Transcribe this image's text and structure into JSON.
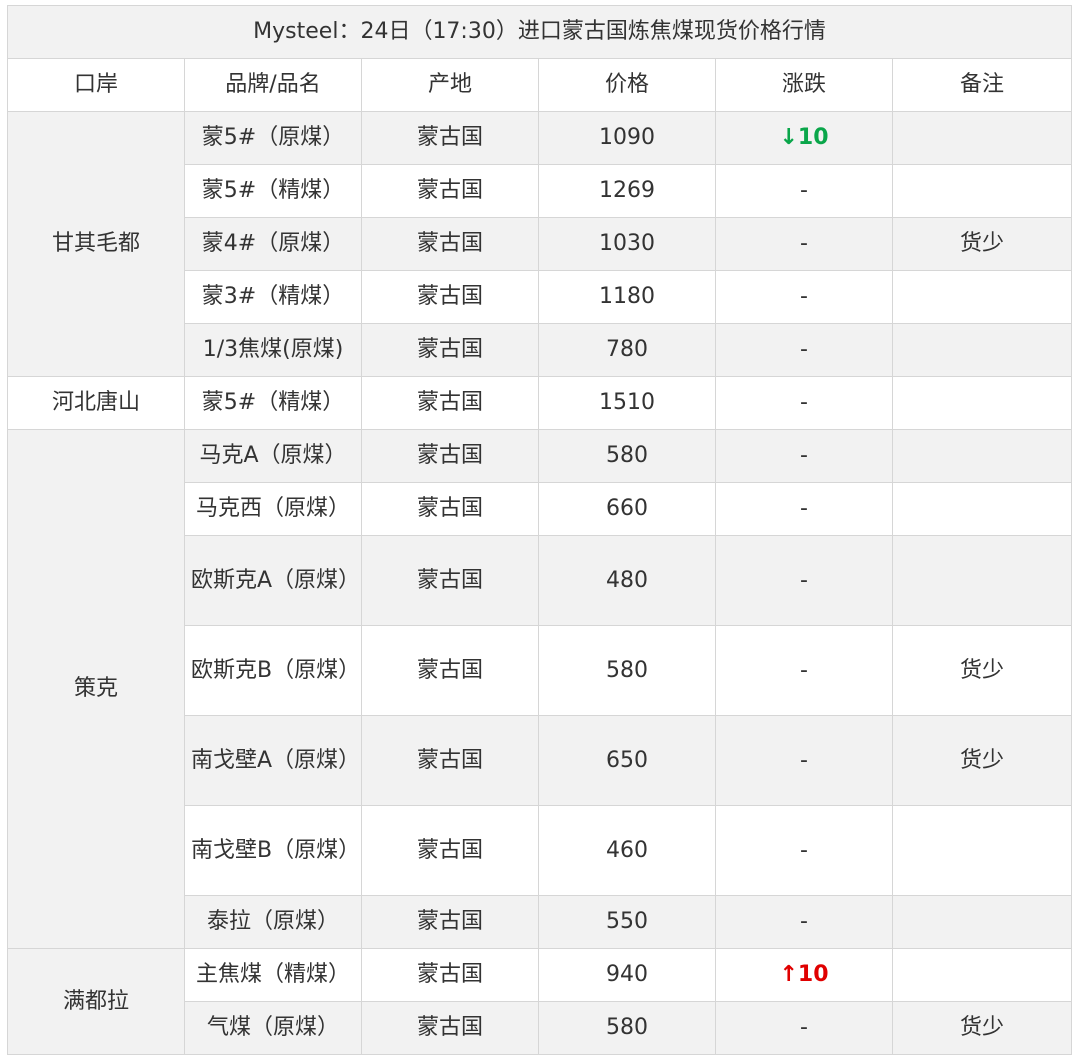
{
  "title": "Mysteel：24日（17:30）进口蒙古国炼焦煤现货价格行情",
  "headers": [
    "口岸",
    "品牌/品名",
    "产地",
    "价格",
    "涨跌",
    "备注"
  ],
  "groups": [
    {
      "port": "甘其毛都",
      "rows": [
        {
          "brand": "蒙5#（原煤）",
          "origin": "蒙古国",
          "price": "1090",
          "change": {
            "dir": "down",
            "arrow": "↓",
            "value": "10"
          },
          "note": ""
        },
        {
          "brand": "蒙5#（精煤）",
          "origin": "蒙古国",
          "price": "1269",
          "change": {
            "text": "-"
          },
          "note": ""
        },
        {
          "brand": "蒙4#（原煤）",
          "origin": "蒙古国",
          "price": "1030",
          "change": {
            "text": "-"
          },
          "note": "货少"
        },
        {
          "brand": "蒙3#（精煤）",
          "origin": "蒙古国",
          "price": "1180",
          "change": {
            "text": "-"
          },
          "note": ""
        },
        {
          "brand": "1/3焦煤(原煤)",
          "origin": "蒙古国",
          "price": "780",
          "change": {
            "text": "-"
          },
          "note": ""
        }
      ]
    },
    {
      "port": "河北唐山",
      "rows": [
        {
          "brand": "蒙5#（精煤）",
          "origin": "蒙古国",
          "price": "1510",
          "change": {
            "text": "-"
          },
          "note": ""
        }
      ]
    },
    {
      "port": "策克",
      "rows": [
        {
          "brand": "马克A（原煤）",
          "origin": "蒙古国",
          "price": "580",
          "change": {
            "text": "-"
          },
          "note": ""
        },
        {
          "brand": "马克西（原煤）",
          "origin": "蒙古国",
          "price": "660",
          "change": {
            "text": "-"
          },
          "note": ""
        },
        {
          "brand": "欧斯克A（原煤）",
          "origin": "蒙古国",
          "price": "480",
          "change": {
            "text": "-"
          },
          "note": ""
        },
        {
          "brand": "欧斯克B（原煤）",
          "origin": "蒙古国",
          "price": "580",
          "change": {
            "text": "-"
          },
          "note": "货少"
        },
        {
          "brand": "南戈壁A（原煤）",
          "origin": "蒙古国",
          "price": "650",
          "change": {
            "text": "-"
          },
          "note": "货少"
        },
        {
          "brand": "南戈壁B（原煤）",
          "origin": "蒙古国",
          "price": "460",
          "change": {
            "text": "-"
          },
          "note": ""
        },
        {
          "brand": "泰拉（原煤）",
          "origin": "蒙古国",
          "price": "550",
          "change": {
            "text": "-"
          },
          "note": ""
        }
      ]
    },
    {
      "port": "满都拉",
      "rows": [
        {
          "brand": "主焦煤（精煤）",
          "origin": "蒙古国",
          "price": "940",
          "change": {
            "dir": "up",
            "arrow": "↑",
            "value": "10"
          },
          "note": ""
        },
        {
          "brand": "气煤（原煤）",
          "origin": "蒙古国",
          "price": "580",
          "change": {
            "text": "-"
          },
          "note": "货少"
        }
      ]
    }
  ]
}
